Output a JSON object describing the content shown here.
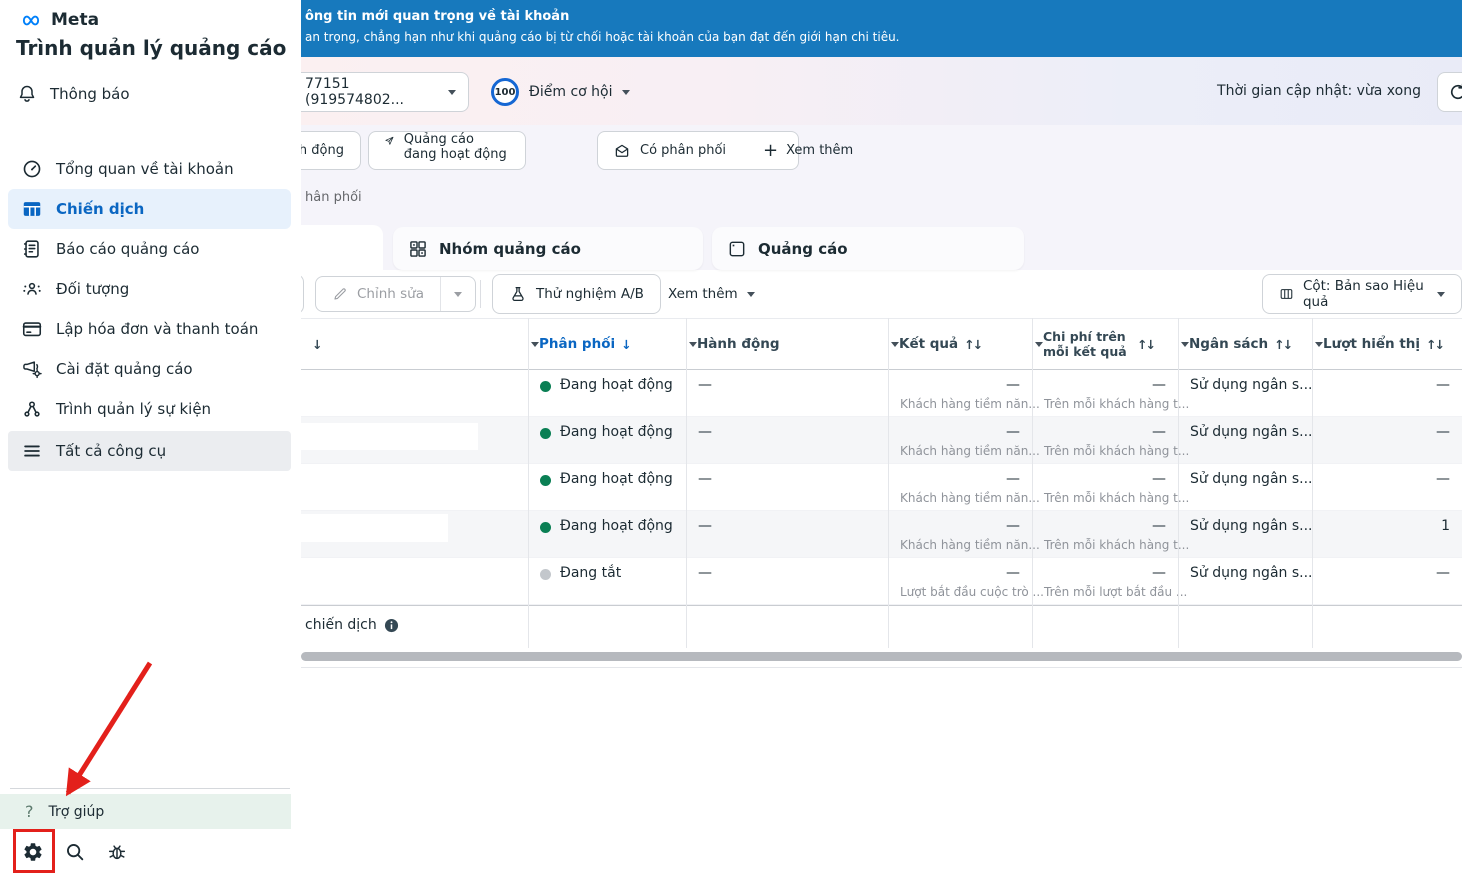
{
  "colors": {
    "banner_blue": "#1779bd",
    "accent_blue": "#0a66c2",
    "active_green": "#0a7f54",
    "inactive_gray": "#c3c7cc",
    "alert_red": "#e3201b"
  },
  "icons": {
    "question": "?",
    "plus": "+"
  },
  "sidebar": {
    "logo_text": "Meta",
    "app_title": "Trình quản lý quảng cáo",
    "notifications_label": "Thông báo",
    "items": [
      {
        "name": "account-overview",
        "icon": "gauge",
        "label": "Tổng quan về tài khoản",
        "active": false
      },
      {
        "name": "campaigns",
        "icon": "table",
        "label": "Chiến dịch",
        "active": true
      },
      {
        "name": "ads-reporting",
        "icon": "report",
        "label": "Báo cáo quảng cáo",
        "active": false
      },
      {
        "name": "audiences",
        "icon": "audience",
        "label": "Đối tượng",
        "active": false
      },
      {
        "name": "billing",
        "icon": "billing",
        "label": "Lập hóa đơn và thanh toán",
        "active": false
      },
      {
        "name": "ad-settings",
        "icon": "adsettings",
        "label": "Cài đặt quảng cáo",
        "active": false
      },
      {
        "name": "events-manager",
        "icon": "events",
        "label": "Trình quản lý sự kiện",
        "active": false
      },
      {
        "name": "all-tools",
        "icon": "menu",
        "label": "Tất cả công cụ",
        "active": false,
        "variant": "gray"
      }
    ],
    "help_label": "Trợ giúp"
  },
  "banner": {
    "title": "ông tin mới quan trọng về tài khoản",
    "subtitle": "an trọng, chẳng hạn như khi quảng cáo bị từ chối hoặc tài khoản của bạn đạt đến giới hạn chi tiêu."
  },
  "account_bar": {
    "account_value": "77151 (919574802...",
    "score_value": "100",
    "score_label": "Điểm cơ hội",
    "updated_label": "Thời gian cập nhật: vừa xong"
  },
  "filter_bar": {
    "chip_partial": "h động",
    "chip_active_ads": "Quảng cáo đang hoạt động",
    "chip_delivery": "Có phân phối",
    "more_label": "Xem thêm",
    "partial_breadcrumb": "hân phối"
  },
  "tabs": {
    "ad_sets": "Nhóm quảng cáo",
    "ads": "Quảng cáo"
  },
  "toolbar": {
    "edit_label": "Chỉnh sửa",
    "ab_test_label": "Thử nghiệm A/B",
    "more_label": "Xem thêm",
    "columns_label": "Cột: Bản sao Hiệu quả"
  },
  "table": {
    "headers": {
      "name_sort": "↓",
      "delivery": "Phân phối",
      "delivery_sort": "↓",
      "action": "Hành động",
      "results": "Kết quả",
      "cost_per_result": "Chi phí trên mỗi kết quả",
      "budget": "Ngân sách",
      "impressions": "Lượt hiển thị",
      "sort_both": "↑↓"
    },
    "rows": [
      {
        "status": "Đang hoạt động",
        "state": "on",
        "action": "—",
        "result": "—",
        "result_sub": "Khách hàng tiềm năn...",
        "cost": "—",
        "cost_sub": "Trên mỗi khách hàng t...",
        "budget": "Sử dụng ngân s...",
        "impressions": "—",
        "redacted": false
      },
      {
        "status": "Đang hoạt động",
        "state": "on",
        "action": "—",
        "result": "—",
        "result_sub": "Khách hàng tiềm năn...",
        "cost": "—",
        "cost_sub": "Trên mỗi khách hàng t...",
        "budget": "Sử dụng ngân s...",
        "impressions": "—",
        "redacted": true
      },
      {
        "status": "Đang hoạt động",
        "state": "on",
        "action": "—",
        "result": "—",
        "result_sub": "Khách hàng tiềm năn...",
        "cost": "—",
        "cost_sub": "Trên mỗi khách hàng t...",
        "budget": "Sử dụng ngân s...",
        "impressions": "—",
        "redacted": false
      },
      {
        "status": "Đang hoạt động",
        "state": "on",
        "action": "—",
        "result": "—",
        "result_sub": "Khách hàng tiềm năn...",
        "cost": "—",
        "cost_sub": "Trên mỗi khách hàng t...",
        "budget": "Sử dụng ngân s...",
        "impressions": "1",
        "redacted": true
      },
      {
        "status": "Đang tắt",
        "state": "off",
        "action": "—",
        "result": "—",
        "result_sub": "Lượt bắt đầu cuộc trò ...",
        "cost": "—",
        "cost_sub": "Trên mỗi lượt bắt đầu ...",
        "budget": "Sử dụng ngân s...",
        "impressions": "—",
        "redacted": false
      }
    ],
    "footer_label": "chiến dịch"
  }
}
